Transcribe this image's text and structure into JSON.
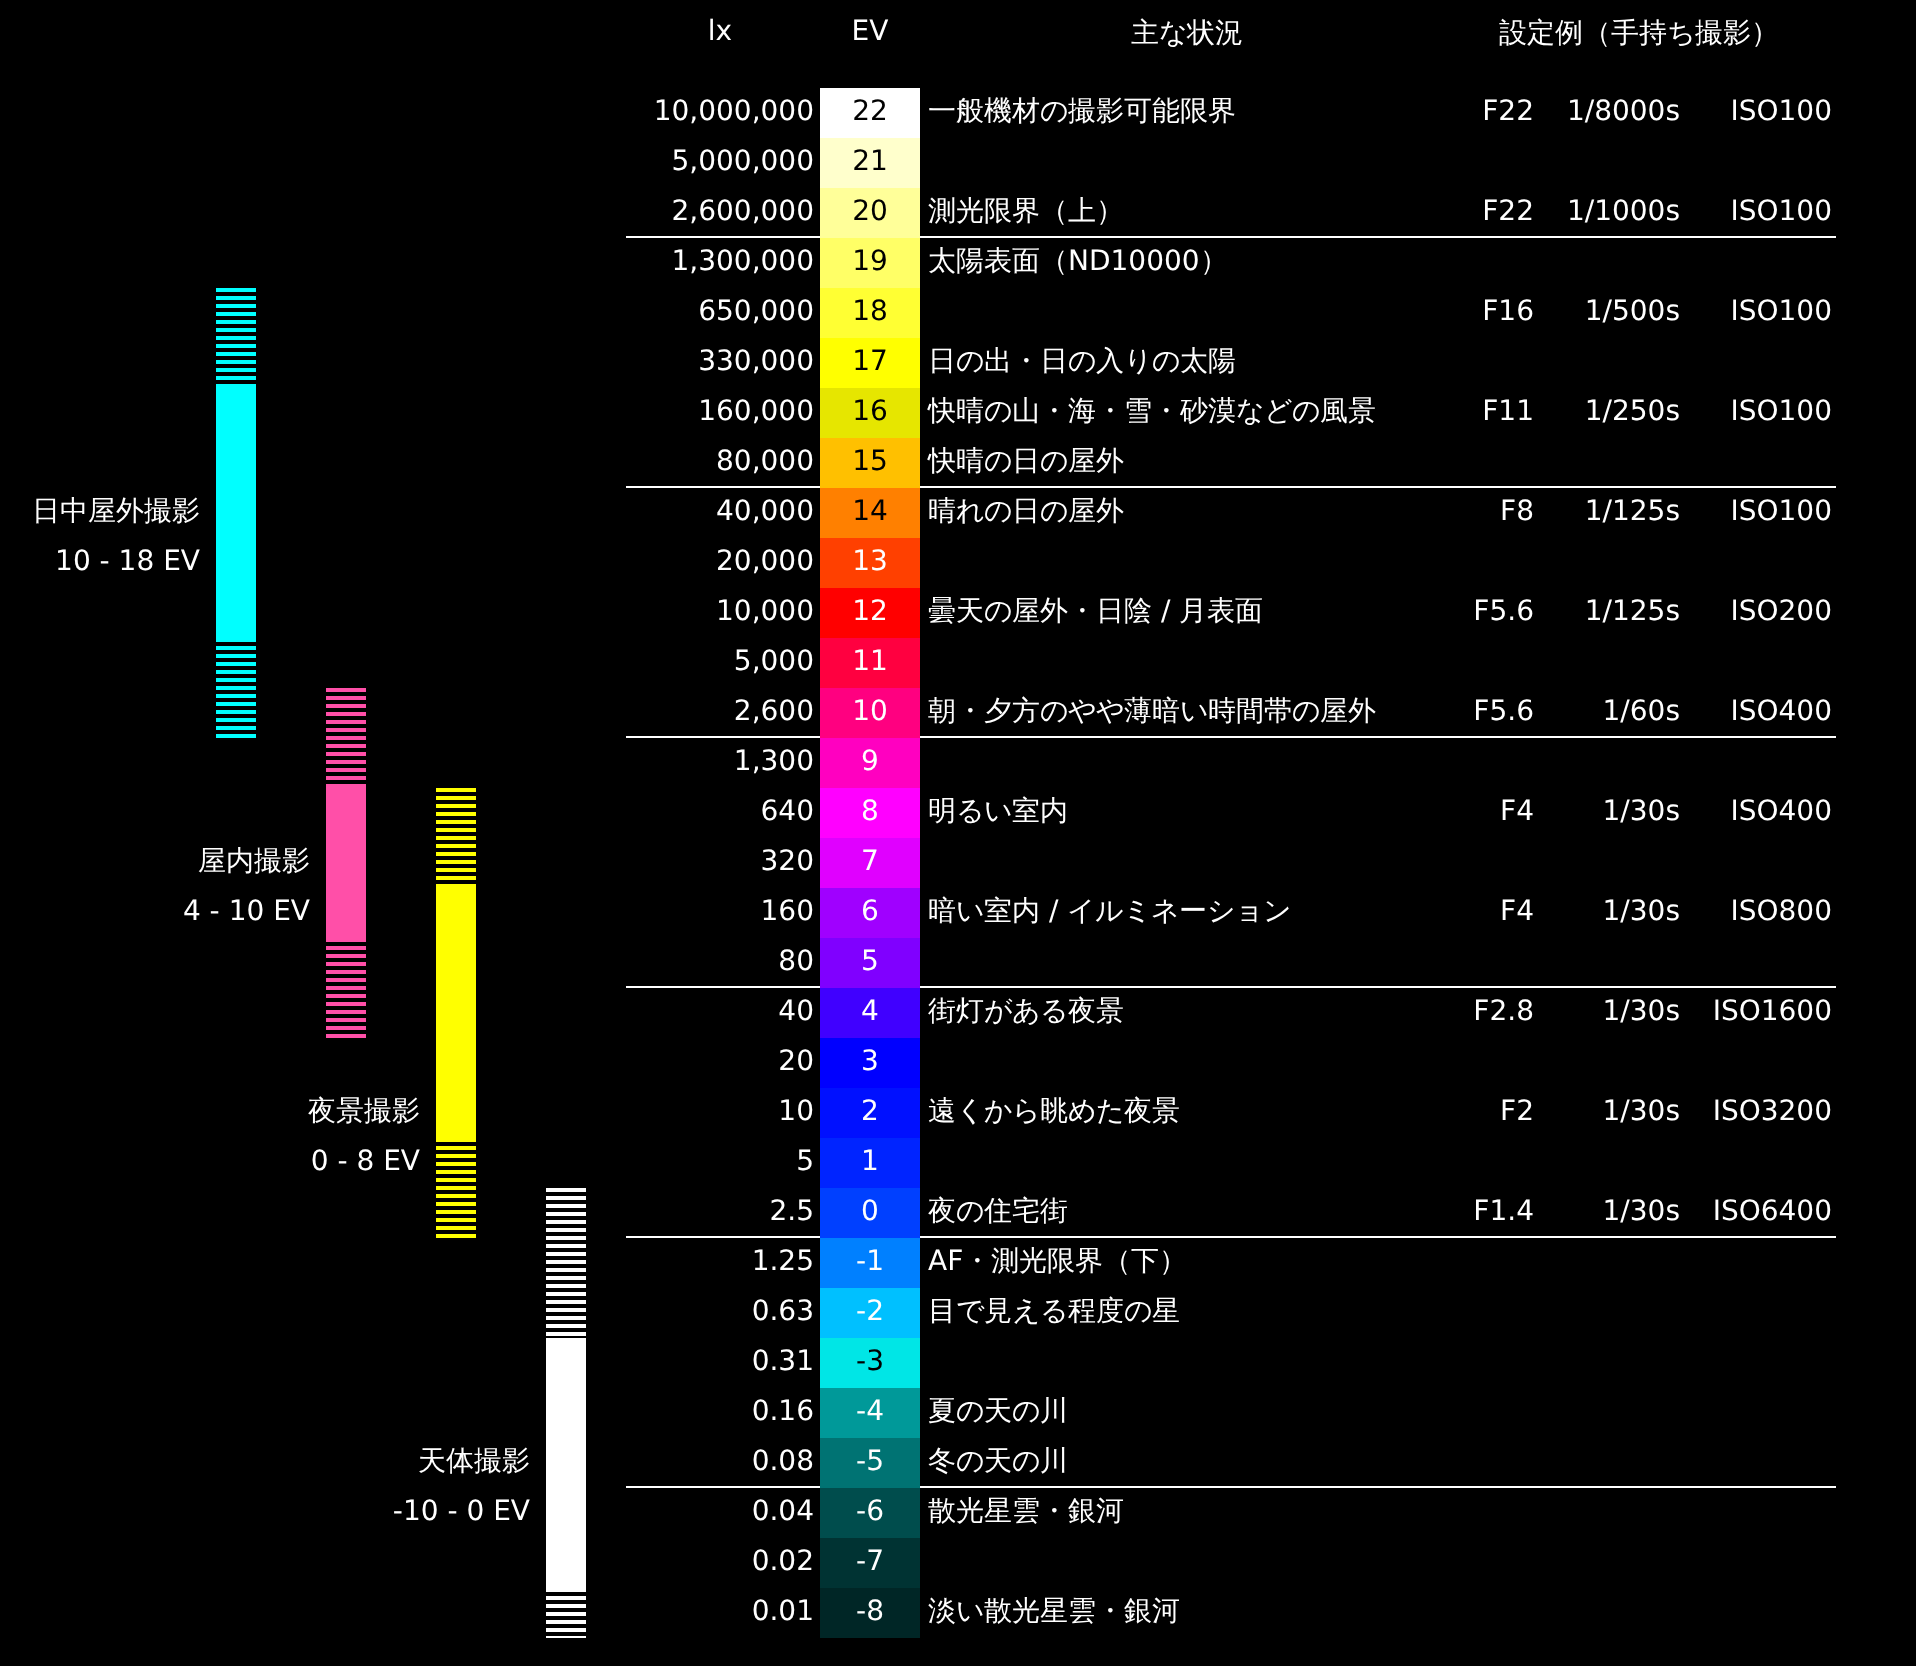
{
  "headers": {
    "lx": "lx",
    "ev": "EV",
    "situation": "主な状況",
    "settings": "設定例（手持ち撮影）"
  },
  "rows": [
    {
      "lx": "10,000,000",
      "ev": "22",
      "color": "#ffffff",
      "text": "一般機材の撮影可能限界",
      "f": "F22",
      "shutter": "1/8000s",
      "iso": "ISO100",
      "divider_after": false
    },
    {
      "lx": "5,000,000",
      "ev": "21",
      "color": "#ffffcc",
      "divider_after": false
    },
    {
      "lx": "2,600,000",
      "ev": "20",
      "color": "#ffff99",
      "text": "測光限界（上）",
      "f": "F22",
      "shutter": "1/1000s",
      "iso": "ISO100",
      "divider_after": true
    },
    {
      "lx": "1,300,000",
      "ev": "19",
      "color": "#ffff66",
      "text": "太陽表面（ND10000）",
      "divider_after": false
    },
    {
      "lx": "650,000",
      "ev": "18",
      "color": "#ffff33",
      "f": "F16",
      "shutter": "1/500s",
      "iso": "ISO100",
      "divider_after": false
    },
    {
      "lx": "330,000",
      "ev": "17",
      "color": "#ffff00",
      "text": "日の出・日の入りの太陽",
      "divider_after": false
    },
    {
      "lx": "160,000",
      "ev": "16",
      "color": "#e6e600",
      "text": "快晴の山・海・雪・砂漠などの風景",
      "f": "F11",
      "shutter": "1/250s",
      "iso": "ISO100",
      "divider_after": false
    },
    {
      "lx": "80,000",
      "ev": "15",
      "color": "#ffc000",
      "text": "快晴の日の屋外",
      "divider_after": true
    },
    {
      "lx": "40,000",
      "ev": "14",
      "color": "#ff8000",
      "text": "晴れの日の屋外",
      "f": "F8",
      "shutter": "1/125s",
      "iso": "ISO100",
      "divider_after": false
    },
    {
      "lx": "20,000",
      "ev": "13",
      "color": "#ff4000",
      "divider_after": false
    },
    {
      "lx": "10,000",
      "ev": "12",
      "color": "#ff0000",
      "text": "曇天の屋外・日陰 / 月表面",
      "f": "F5.6",
      "shutter": "1/125s",
      "iso": "ISO200",
      "divider_after": false
    },
    {
      "lx": "5,000",
      "ev": "11",
      "color": "#ff0040",
      "divider_after": false
    },
    {
      "lx": "2,600",
      "ev": "10",
      "color": "#ff0080",
      "text": "朝・夕方のやや薄暗い時間帯の屋外",
      "f": "F5.6",
      "shutter": "1/60s",
      "iso": "ISO400",
      "divider_after": true
    },
    {
      "lx": "1,300",
      "ev": "9",
      "color": "#ff00c0",
      "divider_after": false
    },
    {
      "lx": "640",
      "ev": "8",
      "color": "#ff00ff",
      "text": "明るい室内",
      "f": "F4",
      "shutter": "1/30s",
      "iso": "ISO400",
      "divider_after": false
    },
    {
      "lx": "320",
      "ev": "7",
      "color": "#e000ff",
      "divider_after": false
    },
    {
      "lx": "160",
      "ev": "6",
      "color": "#a000ff",
      "text": "暗い室内 / イルミネーション",
      "f": "F4",
      "shutter": "1/30s",
      "iso": "ISO800",
      "divider_after": false
    },
    {
      "lx": "80",
      "ev": "5",
      "color": "#8000ff",
      "divider_after": true
    },
    {
      "lx": "40",
      "ev": "4",
      "color": "#4000ff",
      "text": "街灯がある夜景",
      "f": "F2.8",
      "shutter": "1/30s",
      "iso": "ISO1600",
      "divider_after": false
    },
    {
      "lx": "20",
      "ev": "3",
      "color": "#0000ff",
      "divider_after": false
    },
    {
      "lx": "10",
      "ev": "2",
      "color": "#0010ff",
      "text": "遠くから眺めた夜景",
      "f": "F2",
      "shutter": "1/30s",
      "iso": "ISO3200",
      "divider_after": false
    },
    {
      "lx": "5",
      "ev": "1",
      "color": "#0024ff",
      "divider_after": false
    },
    {
      "lx": "2.5",
      "ev": "0",
      "color": "#0040ff",
      "text": "夜の住宅街",
      "f": "F1.4",
      "shutter": "1/30s",
      "iso": "ISO6400",
      "divider_after": true
    },
    {
      "lx": "1.25",
      "ev": "-1",
      "color": "#0080ff",
      "text": "AF・測光限界（下）",
      "divider_after": false
    },
    {
      "lx": "0.63",
      "ev": "-2",
      "color": "#00c0ff",
      "text": "目で見える程度の星",
      "divider_after": false
    },
    {
      "lx": "0.31",
      "ev": "-3",
      "color": "#00e6e6",
      "divider_after": false
    },
    {
      "lx": "0.16",
      "ev": "-4",
      "color": "#009999",
      "text": "夏の天の川",
      "divider_after": false
    },
    {
      "lx": "0.08",
      "ev": "-5",
      "color": "#007373",
      "text": "冬の天の川",
      "divider_after": true
    },
    {
      "lx": "0.04",
      "ev": "-6",
      "color": "#004d4d",
      "text": "散光星雲・銀河",
      "divider_after": false
    },
    {
      "lx": "0.02",
      "ev": "-7",
      "color": "#003333",
      "divider_after": false
    },
    {
      "lx": "0.01",
      "ev": "-8",
      "color": "#002626",
      "text": "淡い散光星雲・銀河",
      "divider_after": false
    }
  ],
  "bands": [
    {
      "label": "日中屋外撮影",
      "range": "10 - 18 EV",
      "color": "#00ffff",
      "cells": [
        {
          "kind": "gap"
        },
        {
          "kind": "gap"
        },
        {
          "kind": "gap"
        },
        {
          "kind": "gap"
        },
        {
          "kind": "stripe"
        },
        {
          "kind": "stripe"
        },
        {
          "kind": "solid"
        },
        {
          "kind": "solid"
        },
        {
          "kind": "labeled"
        },
        {
          "kind": "solid"
        },
        {
          "kind": "solid"
        },
        {
          "kind": "stripe"
        },
        {
          "kind": "stripe"
        },
        {
          "kind": "gap"
        },
        {
          "kind": "gap"
        },
        {
          "kind": "gap"
        },
        {
          "kind": "gap"
        },
        {
          "kind": "gap"
        },
        {
          "kind": "gap"
        },
        {
          "kind": "gap"
        },
        {
          "kind": "gap"
        },
        {
          "kind": "gap"
        },
        {
          "kind": "gap"
        },
        {
          "kind": "gap"
        },
        {
          "kind": "gap"
        },
        {
          "kind": "gap"
        },
        {
          "kind": "gap"
        },
        {
          "kind": "gap"
        },
        {
          "kind": "gap"
        },
        {
          "kind": "gap"
        },
        {
          "kind": "gap"
        }
      ]
    },
    {
      "label": "屋内撮影",
      "range": "4 - 10 EV",
      "color": "#ff4fa8",
      "cells": [
        {
          "kind": "gap"
        },
        {
          "kind": "gap"
        },
        {
          "kind": "gap"
        },
        {
          "kind": "gap"
        },
        {
          "kind": "gap"
        },
        {
          "kind": "gap"
        },
        {
          "kind": "gap"
        },
        {
          "kind": "gap"
        },
        {
          "kind": "gap"
        },
        {
          "kind": "gap"
        },
        {
          "kind": "gap"
        },
        {
          "kind": "gap"
        },
        {
          "kind": "stripe"
        },
        {
          "kind": "stripe"
        },
        {
          "kind": "solid"
        },
        {
          "kind": "labeled"
        },
        {
          "kind": "solid"
        },
        {
          "kind": "stripe"
        },
        {
          "kind": "stripe"
        },
        {
          "kind": "gap"
        },
        {
          "kind": "gap"
        },
        {
          "kind": "gap"
        },
        {
          "kind": "gap"
        },
        {
          "kind": "gap"
        },
        {
          "kind": "gap"
        },
        {
          "kind": "gap"
        },
        {
          "kind": "gap"
        },
        {
          "kind": "gap"
        },
        {
          "kind": "gap"
        },
        {
          "kind": "gap"
        },
        {
          "kind": "gap"
        }
      ]
    },
    {
      "label": "夜景撮影",
      "range": "0 - 8 EV",
      "color": "#ffff00",
      "cells": [
        {
          "kind": "gap"
        },
        {
          "kind": "gap"
        },
        {
          "kind": "gap"
        },
        {
          "kind": "gap"
        },
        {
          "kind": "gap"
        },
        {
          "kind": "gap"
        },
        {
          "kind": "gap"
        },
        {
          "kind": "gap"
        },
        {
          "kind": "gap"
        },
        {
          "kind": "gap"
        },
        {
          "kind": "gap"
        },
        {
          "kind": "gap"
        },
        {
          "kind": "gap"
        },
        {
          "kind": "gap"
        },
        {
          "kind": "stripe"
        },
        {
          "kind": "stripe"
        },
        {
          "kind": "solid"
        },
        {
          "kind": "solid"
        },
        {
          "kind": "solid"
        },
        {
          "kind": "solid"
        },
        {
          "kind": "labeled"
        },
        {
          "kind": "stripe"
        },
        {
          "kind": "stripe"
        },
        {
          "kind": "gap"
        },
        {
          "kind": "gap"
        },
        {
          "kind": "gap"
        },
        {
          "kind": "gap"
        },
        {
          "kind": "gap"
        },
        {
          "kind": "gap"
        },
        {
          "kind": "gap"
        },
        {
          "kind": "gap"
        }
      ]
    },
    {
      "label": "天体撮影",
      "range": "-10 - 0 EV",
      "color": "#ffffff",
      "cells": [
        {
          "kind": "gap"
        },
        {
          "kind": "gap"
        },
        {
          "kind": "gap"
        },
        {
          "kind": "gap"
        },
        {
          "kind": "gap"
        },
        {
          "kind": "gap"
        },
        {
          "kind": "gap"
        },
        {
          "kind": "gap"
        },
        {
          "kind": "gap"
        },
        {
          "kind": "gap"
        },
        {
          "kind": "gap"
        },
        {
          "kind": "gap"
        },
        {
          "kind": "gap"
        },
        {
          "kind": "gap"
        },
        {
          "kind": "gap"
        },
        {
          "kind": "gap"
        },
        {
          "kind": "gap"
        },
        {
          "kind": "gap"
        },
        {
          "kind": "gap"
        },
        {
          "kind": "gap"
        },
        {
          "kind": "gap"
        },
        {
          "kind": "gap"
        },
        {
          "kind": "stripe"
        },
        {
          "kind": "stripe"
        },
        {
          "kind": "stripe"
        },
        {
          "kind": "solid"
        },
        {
          "kind": "solid"
        },
        {
          "kind": "labeled"
        },
        {
          "kind": "solid"
        },
        {
          "kind": "solid"
        },
        {
          "kind": "stripe"
        }
      ]
    }
  ]
}
